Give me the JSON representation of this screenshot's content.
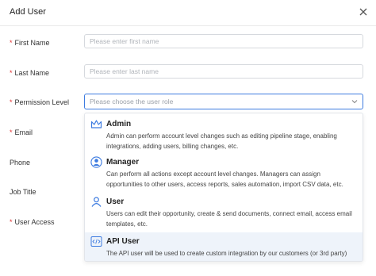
{
  "dialog": {
    "title": "Add User"
  },
  "form": {
    "first_name": {
      "label": "First Name",
      "required": true,
      "placeholder": "Please enter first name"
    },
    "last_name": {
      "label": "Last Name",
      "required": true,
      "placeholder": "Please enter last name"
    },
    "permission_level": {
      "label": "Permission Level",
      "required": true,
      "placeholder": "Please choose the user role"
    },
    "email": {
      "label": "Email",
      "required": true
    },
    "phone": {
      "label": "Phone",
      "required": false
    },
    "job_title": {
      "label": "Job Title",
      "required": false
    },
    "user_access": {
      "label": "User Access",
      "required": true
    }
  },
  "required_mark": "*",
  "roles": [
    {
      "title": "Admin",
      "icon": "crown-icon",
      "description": "Admin can perform account level changes such as editing pipeline stage, enabling integrations, adding users, billing changes, etc."
    },
    {
      "title": "Manager",
      "icon": "manager-user-icon",
      "description": "Can perform all actions except account level changes. Managers can assign opportunities to other users, access reports, sales automation, import CSV data, etc."
    },
    {
      "title": "User",
      "icon": "user-icon",
      "description": "Users can edit their opportunity, create & send documents, connect email, access email templates, etc."
    },
    {
      "title": "API User",
      "icon": "code-icon",
      "description": "The API user will be used to create custom integration by our customers (or 3rd party)"
    }
  ],
  "colors": {
    "accent": "#3d7be0",
    "required": "#e03131",
    "highlight": "#eef3fa"
  }
}
